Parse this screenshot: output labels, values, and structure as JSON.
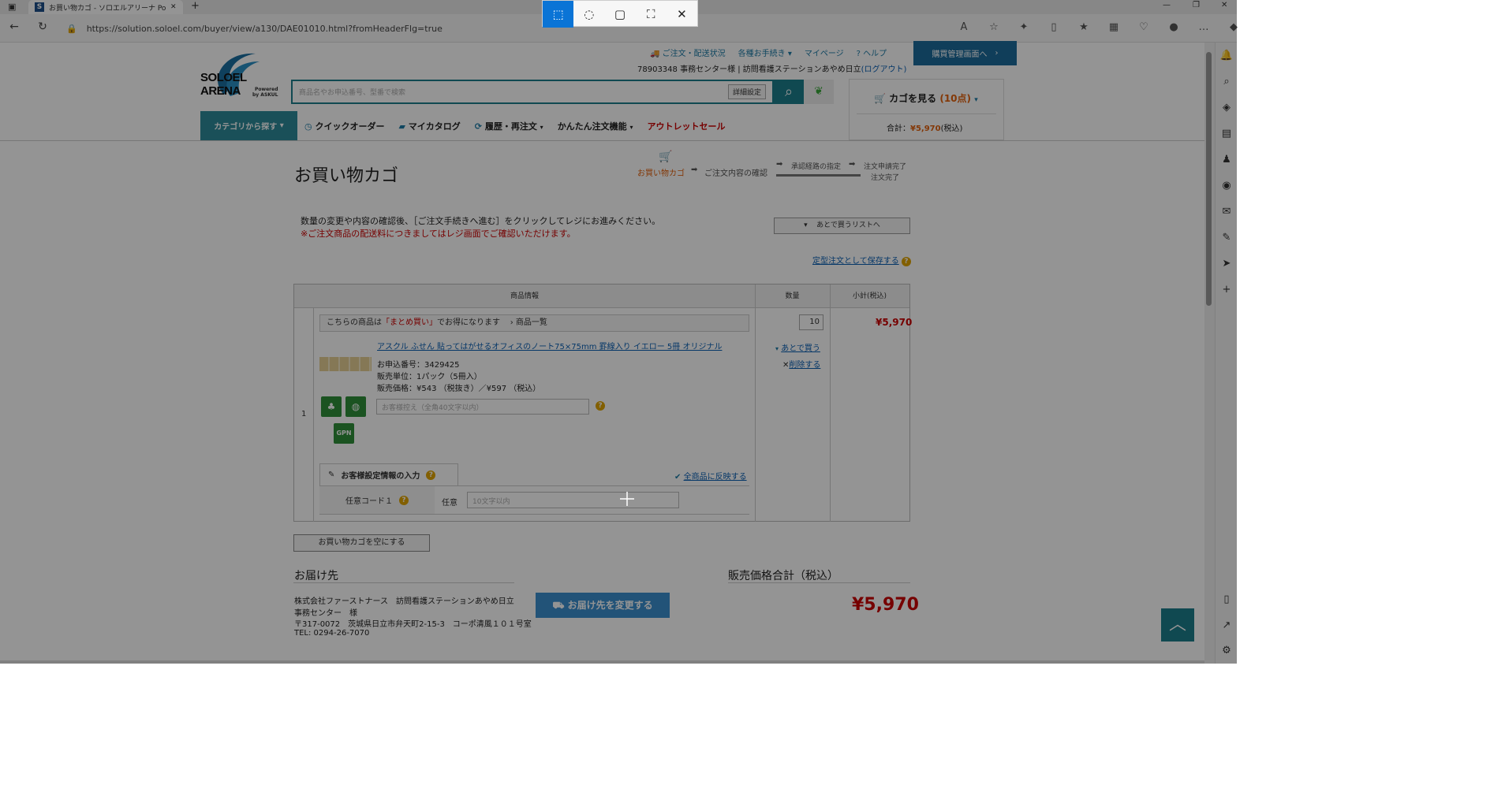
{
  "browser": {
    "tab_title": "お買い物カゴ - ソロエルアリーナ Powe",
    "favicon": "S",
    "url": "https://solution.soloel.com/buyer/view/a130/DAE01010.html?fromHeaderFlg=true"
  },
  "logo": {
    "main": "SOLOEL ARENA",
    "sub1": "Powered",
    "sub2": "by ASKUL"
  },
  "header": {
    "links": [
      "ご注文・配送状況",
      "各種お手続き ▾",
      "マイページ",
      "ヘルプ"
    ],
    "user": "78903348 事務センター様 | 訪問看護ステーションあやめ日立",
    "logout": "(ログアウト)",
    "mgmt_button": "購買管理画面へ",
    "search_placeholder": "商品名やお申込番号、型番で検索",
    "detail_settings": "詳細設定",
    "cart_view": "カゴを見る",
    "cart_count": "(10点)",
    "cart_total_label": "合計：",
    "cart_total": "¥5,970",
    "cart_tax": "(税込)"
  },
  "nav": {
    "category": "カテゴリから探す",
    "items": [
      "クイックオーダー",
      "マイカタログ",
      "履歴・再注文",
      "かんたん注文機能",
      "アウトレットセール"
    ]
  },
  "page": {
    "title": "お買い物カゴ",
    "steps": [
      "お買い物カゴ",
      "ご注文内容の確認",
      "承認経路の指定",
      "注文申請完了",
      "注文完了"
    ],
    "instruction": "数量の変更や内容の確認後、［ご注文手続きへ進む］をクリックしてレジにお進みください。",
    "notice": "※ご注文商品の配送料につきましてはレジ画面でご確認いただけます。",
    "later_list": "あとで買うリストへ",
    "save_fixed": "定型注文として保存する"
  },
  "table": {
    "headers": [
      "商品情報",
      "数量",
      "小計(税込)"
    ],
    "bulk_pre": "こちらの商品は",
    "bulk_hl": "「まとめ買い」",
    "bulk_post": "でお得になります",
    "bulk_link": "商品一覧",
    "row_number": "1",
    "product_name": "アスクル ふせん 貼ってはがせるオフィスのノート75×75mm 罫線入り イエロー 5冊 オリジナル",
    "order_no": "お申込番号：3429425",
    "unit": "販売単位：1パック（5冊入）",
    "unit_price": "販売価格：¥543 （税抜き）／¥597 （税込）",
    "memo_placeholder": "お客様控え（全角40文字以内）",
    "gpn": "GPN",
    "quantity": "10",
    "subtotal": "¥5,970",
    "buy_later": "あとで買う",
    "delete": "削除する",
    "cust_info": "お客様設定情報の入力",
    "apply_all": "全商品に反映する",
    "code_label": "任意コード１",
    "optional": "任意",
    "code_placeholder": "10文字以内"
  },
  "empty_cart": "お買い物カゴを空にする",
  "shipping": {
    "title": "お届け先",
    "lines": [
      "株式会社ファーストナース　訪問看護ステーションあやめ日立",
      "事務センター　様",
      "〒317-0072　茨城県日立市弁天町2-15-3　コーポ清風１０１号室",
      "TEL: 0294-26-7070"
    ],
    "change": "お届け先を変更する"
  },
  "total": {
    "title": "販売価格合計（税込）",
    "amount": "¥5,970"
  },
  "colors": {
    "teal": "#1d7e8c",
    "red": "#c00000",
    "overlay": "rgba(0,0,0,0.42)",
    "snip_active": "#0a74d6"
  }
}
